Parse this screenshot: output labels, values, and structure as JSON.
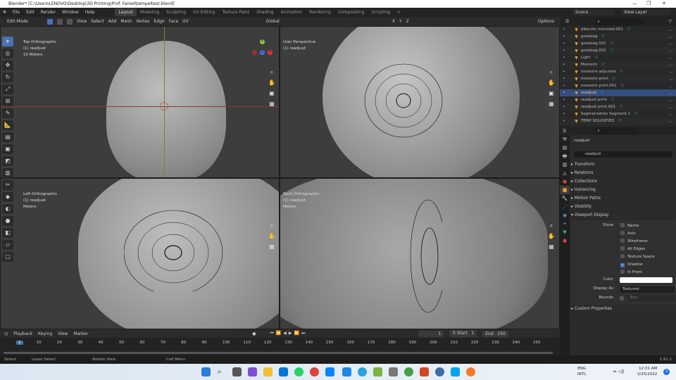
{
  "window": {
    "title": "Blender* [C:\\Users\\LENOVO\\Desktop\\3D Printing\\Prof. Faried\\tempeltest.blend]",
    "minimize": "—",
    "maximize": "❐",
    "close": "✕"
  },
  "menu": [
    "File",
    "Edit",
    "Render",
    "Window",
    "Help"
  ],
  "workspaces": [
    "Layout",
    "Modeling",
    "Sculpting",
    "UV Editing",
    "Texture Paint",
    "Shading",
    "Animation",
    "Rendering",
    "Compositing",
    "Scripting",
    "+"
  ],
  "scene": "Scene",
  "view_layer": "View Layer",
  "header": {
    "mode": "Edit Mode",
    "menus": [
      "View",
      "Select",
      "Add",
      "Mesh",
      "Vertex",
      "Edge",
      "Face",
      "UV"
    ],
    "orientation": "Global",
    "options": "Options",
    "axes": [
      "X",
      "Y",
      "Z"
    ]
  },
  "viewports": [
    {
      "name": "Top Orthographic",
      "object": "(1) readjust",
      "scale": "10 Meters"
    },
    {
      "name": "User Perspective",
      "object": "(1) readjust",
      "scale": ""
    },
    {
      "name": "Left Orthographic",
      "object": "(1) readjust",
      "scale": "Meters"
    },
    {
      "name": "Back Orthographic",
      "object": "(1) readjust",
      "scale": "Meters"
    }
  ],
  "outliner": {
    "items": [
      "dikecilin mirrored.001",
      "goodseg",
      "goodseg.001",
      "goodseg.002",
      "Light",
      "Moresim",
      "moresim adjusted",
      "moresim print",
      "moresim print.001",
      "readjust",
      "readjust print",
      "readjust print.001",
      "Segmentation Segment 1",
      "TEMP SOLIDIFIED"
    ],
    "selected": "readjust"
  },
  "properties": {
    "object_name": "readjust",
    "data_name": "readjust",
    "sections": [
      "Transform",
      "Relations",
      "Collections",
      "Instancing",
      "Motion Paths",
      "Visibility",
      "Viewport Display"
    ],
    "show_label": "Show",
    "show": [
      {
        "label": "Name",
        "checked": false
      },
      {
        "label": "Axis",
        "checked": false
      },
      {
        "label": "Wireframe",
        "checked": false
      },
      {
        "label": "All Edges",
        "checked": false
      },
      {
        "label": "Texture Space",
        "checked": false
      },
      {
        "label": "Shadow",
        "checked": true
      },
      {
        "label": "In Front",
        "checked": false
      }
    ],
    "color_label": "Color",
    "color": "#ffffff",
    "display_as_label": "Display As",
    "display_as": "Textured",
    "bounds_label": "Bounds",
    "bounds": "Box",
    "custom": "Custom Properties"
  },
  "timeline": {
    "menus": [
      "Playback",
      "Keying",
      "View",
      "Marker"
    ],
    "current_frame": "1",
    "start_label": "Start",
    "start": "1",
    "end_label": "End",
    "end": "250",
    "ticks": [
      "1",
      "10",
      "20",
      "30",
      "40",
      "50",
      "60",
      "70",
      "80",
      "90",
      "100",
      "110",
      "120",
      "130",
      "140",
      "150",
      "160",
      "170",
      "180",
      "190",
      "200",
      "210",
      "220",
      "230",
      "240",
      "250"
    ]
  },
  "status": {
    "items": [
      "Select",
      "Lasso Select",
      "Rotate View",
      "Call Menu"
    ],
    "version": "2.91.2"
  },
  "taskbar": {
    "lang1": "ENG",
    "lang2": "INTL",
    "time": "12:01 AM",
    "date": "2/25/2022",
    "badge": "3"
  },
  "colors": {
    "accent": "#4772b3",
    "selected_row": "#334d80",
    "mesh": "#3bb391",
    "object": "#f29c2b"
  }
}
